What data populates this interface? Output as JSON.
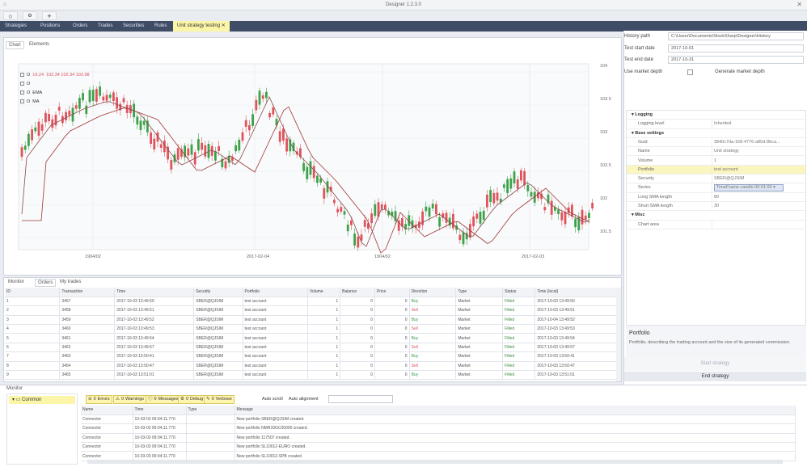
{
  "window": {
    "title": "Designer 1.2.3.0"
  },
  "menu": {
    "items": [
      "Strategies",
      "Positions",
      "Orders",
      "Trades",
      "Securities",
      "Rules"
    ],
    "active": "Unit strategy testing"
  },
  "chart": {
    "tabs": [
      "Chart",
      "Elements"
    ],
    "legend": [
      {
        "color": "#d9545d",
        "text": "19.24"
      },
      {
        "color": "#d9545d",
        "text": "MA"
      },
      {
        "color": "#d9545d",
        "text": "EMA"
      },
      {
        "color": "#d9545d",
        "text": "MA"
      }
    ],
    "ohlc": "102.34 102.34 102.98",
    "y_ticks": [
      "104",
      "103.5",
      "103",
      "102.5",
      "102",
      "101.5"
    ],
    "x_ticks": [
      "1904/02",
      "2017-02-04",
      "1904/02",
      "2017-02-03"
    ]
  },
  "orders": {
    "tabs": [
      "Monitor",
      "Orders",
      "My trades"
    ],
    "columns": [
      "ID",
      "Transaction",
      "Time",
      "Security",
      "Portfolio",
      "Volume",
      "Balance",
      "Price",
      "Direction",
      "Type",
      "Status",
      "Time (local)"
    ],
    "rows": [
      [
        "1",
        "3457",
        "2017-10-03 13:49:50",
        "SBER@QJSIM",
        "test account",
        "1",
        "0",
        "0",
        "Buy",
        "Market",
        "Filled",
        "2017-10-03 13:49:50"
      ],
      [
        "2",
        "3458",
        "2017-10-03 13:49:51",
        "SBER@QJSIM",
        "test account",
        "1",
        "0",
        "0",
        "Sell",
        "Market",
        "Filled",
        "2017-10-03 13:49:51"
      ],
      [
        "3",
        "3459",
        "2017-10-03 13:49:52",
        "SBER@QJSIM",
        "test account",
        "1",
        "0",
        "0",
        "Buy",
        "Market",
        "Filled",
        "2017-10-04 13:49:52"
      ],
      [
        "4",
        "3460",
        "2017-10-03 13:49:53",
        "SBER@QJSIM",
        "test account",
        "1",
        "0",
        "0",
        "Sell",
        "Market",
        "Filled",
        "2017-10-03 13:49:53"
      ],
      [
        "5",
        "3461",
        "2017-10-03 13:49:54",
        "SBER@QJSIM",
        "test account",
        "1",
        "0",
        "0",
        "Buy",
        "Market",
        "Filled",
        "2017-10-03 13:49:54"
      ],
      [
        "6",
        "3462",
        "2017-10-03 13:49:57",
        "SBER@QJSIM",
        "test account",
        "1",
        "0",
        "0",
        "Sell",
        "Market",
        "Filled",
        "2017-10-03 13:49:57"
      ],
      [
        "7",
        "3463",
        "2017-10-03 13:50:41",
        "SBER@QJSIM",
        "test account",
        "1",
        "0",
        "0",
        "Buy",
        "Market",
        "Filled",
        "2017-10-03 13:50:41"
      ],
      [
        "8",
        "3464",
        "2017-10-03 13:50:47",
        "SBER@QJSIM",
        "test account",
        "1",
        "0",
        "0",
        "Sell",
        "Market",
        "Filled",
        "2017-10-03 13:50:47"
      ],
      [
        "9",
        "3465",
        "2017-10-03 13:51:01",
        "SBER@QJSIM",
        "test account",
        "1",
        "0",
        "0",
        "Buy",
        "Market",
        "Filled",
        "2017-10-03 13:51:01"
      ]
    ]
  },
  "settings": {
    "history_path_label": "History path",
    "history_path": "C:\\Users\\Documents\\StockSharp\\Designer\\History",
    "start_date_label": "Test start date",
    "start_date": "2017-10-01",
    "end_date_label": "Test end date",
    "end_date": "2017-10-31",
    "market_depth_label": "Use market depth",
    "generate_depth_label": "Generate market depth"
  },
  "properties": [
    {
      "cat": true,
      "k": "Logging"
    },
    {
      "k": "Logging level",
      "v": "Inherited"
    },
    {
      "cat": true,
      "k": "Base settings"
    },
    {
      "k": "Guid",
      "v": "3840c7da-168-4776-a85d-8bca..."
    },
    {
      "k": "Name",
      "v": "Unit strategy"
    },
    {
      "k": "Volume",
      "v": "1"
    },
    {
      "k": "Portfolio",
      "v": "test account",
      "hl": true
    },
    {
      "k": "Security",
      "v": "SBER@QJSIM"
    },
    {
      "k": "Series",
      "v": "TimeFrame candle 00:01:00",
      "sel": true
    },
    {
      "k": "Long SMA length",
      "v": "80"
    },
    {
      "k": "Short SMA length",
      "v": "30"
    },
    {
      "cat": true,
      "k": "Misc"
    },
    {
      "k": "Chart area",
      "v": ""
    }
  ],
  "description": {
    "title": "Portfolio",
    "text": "Portfolio, describing the trading account and the size of its generated commission."
  },
  "buttons": {
    "start": "Start strategy",
    "end": "End strategy"
  },
  "monitor": {
    "title": "Monitor",
    "tree_root": "Common",
    "filters": [
      {
        "n": "0",
        "t": "Errors",
        "icon": "error-icon"
      },
      {
        "n": "0",
        "t": "Warnings",
        "icon": "warning-icon"
      },
      {
        "n": "0",
        "t": "Messages",
        "icon": "info-icon"
      },
      {
        "n": "0",
        "t": "Debug",
        "icon": "debug-icon"
      },
      {
        "n": "0",
        "t": "Verbose",
        "icon": "verbose-icon"
      }
    ],
    "auto_scroll": "Auto scroll",
    "auto_align": "Auto alignment",
    "columns": [
      "Name",
      "Time",
      "Type",
      "Message"
    ],
    "rows": [
      [
        "Connector",
        "10-03-03 09:04:11.770",
        "",
        "New portfolio SBER@QJSIM created."
      ],
      [
        "Connector",
        "10-03-03 09:04:11.770",
        "",
        "New portfolio NMR33GC00000 created."
      ],
      [
        "Connector",
        "10-03-03 09:04:11.770",
        "",
        "New portfolio 117507 created."
      ],
      [
        "Connector",
        "10-03-03 09:04:11.770",
        "",
        "New portfolio SL10012-EURO created."
      ],
      [
        "Connector",
        "10-03-03 09:04:11.770",
        "",
        "New portfolio SL10012-SPB created."
      ]
    ]
  }
}
